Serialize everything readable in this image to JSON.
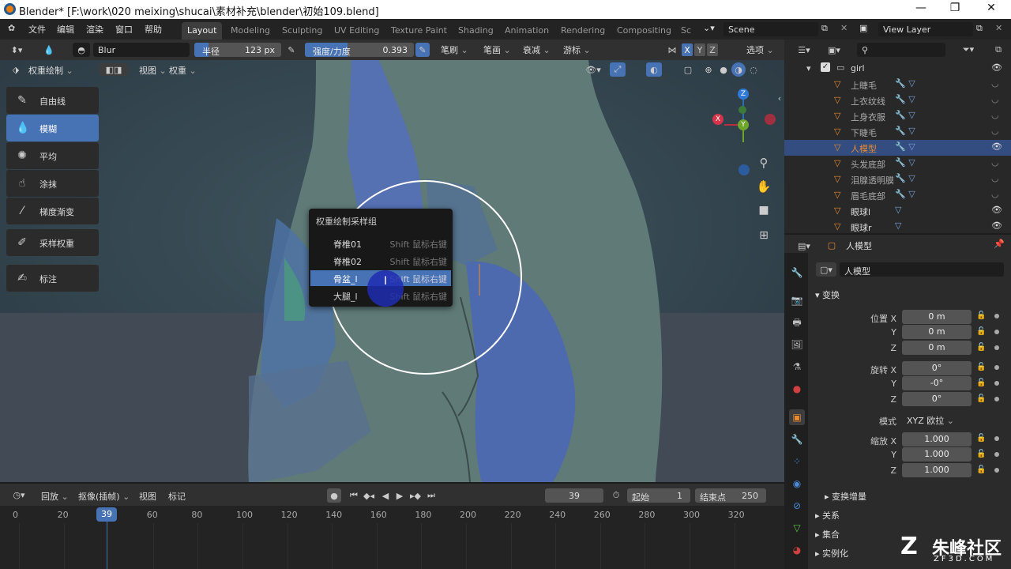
{
  "window": {
    "title": "Blender* [F:\\work\\020 meixing\\shucai\\素材补充\\blender\\初始109.blend]"
  },
  "menu": [
    "文件",
    "编辑",
    "渲染",
    "窗口",
    "帮助"
  ],
  "workspaces": [
    "Layout",
    "Modeling",
    "Sculpting",
    "UV Editing",
    "Texture Paint",
    "Shading",
    "Animation",
    "Rendering",
    "Compositing",
    "Sc"
  ],
  "scene": "Scene",
  "view_layer": "View Layer",
  "tool_header": {
    "brush_name": "Blur",
    "radius_label": "半径",
    "radius_value": "123 px",
    "strength_label": "强度/力度",
    "strength_value": "0.393",
    "strength_fraction": 0.393,
    "dropdowns": [
      "笔刷",
      "笔画",
      "衰减",
      "游标"
    ],
    "axes": [
      "X",
      "Y",
      "Z"
    ],
    "options": "选项"
  },
  "viewport_header": {
    "mode": "权重绘制",
    "view": "视图",
    "weights": "权重"
  },
  "tools": [
    "自由线",
    "模糊",
    "平均",
    "涂抹",
    "梯度渐变",
    "采样权重",
    "标注"
  ],
  "popup": {
    "title": "权重绘制采样组",
    "items": [
      {
        "name": "脊椎01",
        "shortcut": "Shift 鼠标右键"
      },
      {
        "name": "脊椎02",
        "shortcut": "Shift 鼠标右键"
      },
      {
        "name": "骨盆_l",
        "shortcut": "Shift 鼠标右键"
      },
      {
        "name": "大腿_l",
        "shortcut": "Shift 鼠标右键"
      }
    ]
  },
  "gizmo": {
    "x": "X",
    "y": "Y",
    "z": "Z"
  },
  "outliner": {
    "root": "girl",
    "items": [
      "上睫毛",
      "上衣纹线",
      "上身衣服",
      "下睫毛",
      "人模型",
      "头发底部",
      "泪腺透明膜",
      "眉毛底部",
      "眼球l",
      "眼球r"
    ]
  },
  "properties": {
    "object_name": "人模型",
    "data_name": "人模型",
    "transform": "变换",
    "location_label": "位置 X",
    "location": [
      "0 m",
      "0 m",
      "0 m"
    ],
    "rotation_label": "旋转 X",
    "rotation": [
      "0°",
      "-0°",
      "0°"
    ],
    "mode_label": "模式",
    "mode_value": "XYZ 欧拉",
    "scale_label": "缩放 X",
    "scale": [
      "1.000",
      "1.000",
      "1.000"
    ],
    "axis_y": "Y",
    "axis_z": "Z",
    "delta": "变换增量",
    "relations": "关系",
    "collections": "集合",
    "instancing": "实例化"
  },
  "timeline": {
    "playback": "回放",
    "keying": "抠像(插帧)",
    "view": "视图",
    "marker": "标记",
    "current_frame": "39",
    "start_label": "起始",
    "start": "1",
    "end_label": "结束点",
    "end": "250",
    "ticks": [
      "0",
      "20",
      "39",
      "60",
      "80",
      "100",
      "120",
      "140",
      "160",
      "180",
      "200",
      "220",
      "240",
      "260",
      "280",
      "300",
      "320"
    ]
  },
  "watermark": {
    "name": "朱峰社区",
    "url": "ZF3D.COM"
  }
}
